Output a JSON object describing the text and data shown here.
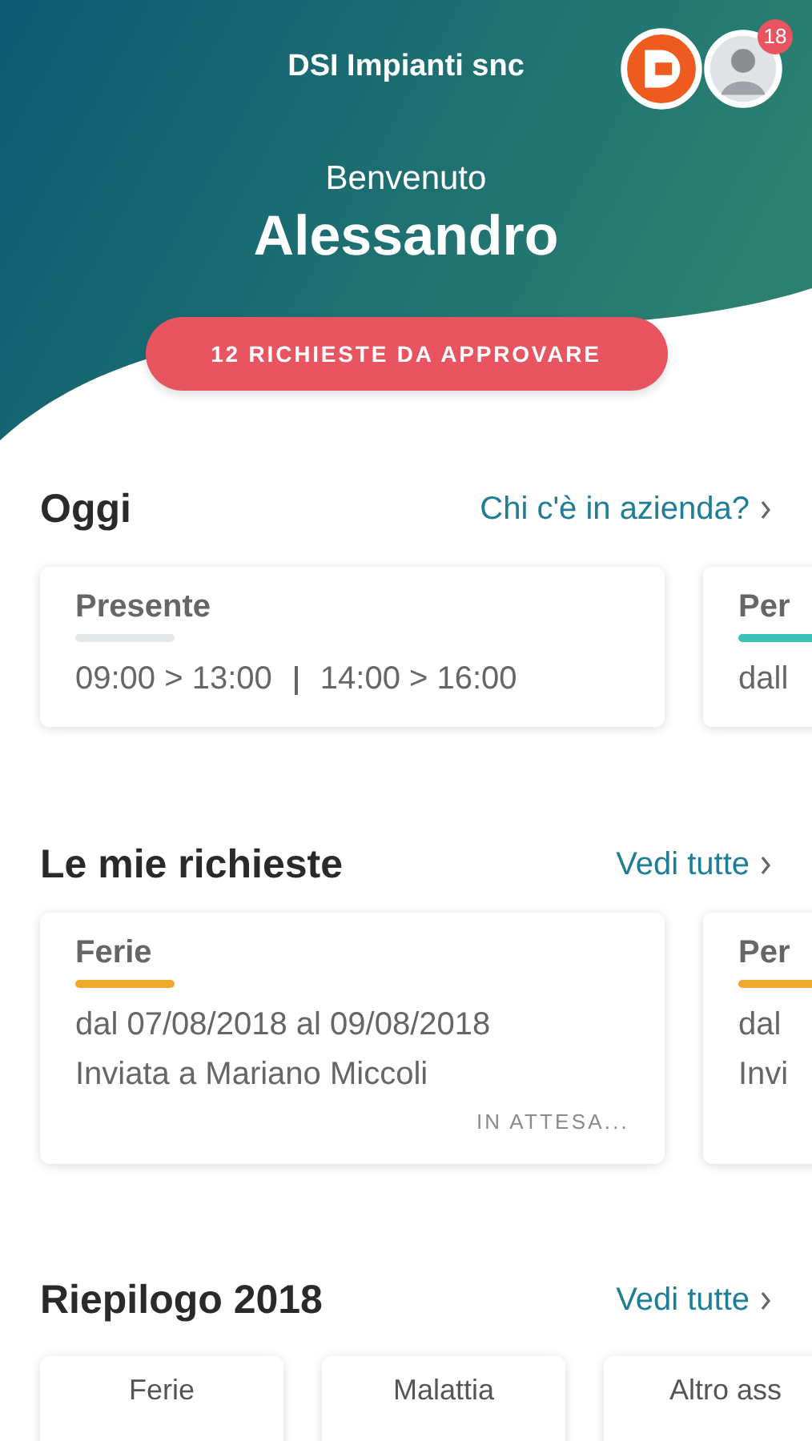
{
  "header": {
    "company": "DSI Impianti snc",
    "notification_count": "18",
    "greeting": "Benvenuto",
    "name": "Alessandro",
    "approve_button": "12 RICHIESTE DA APPROVARE"
  },
  "sections": [
    {
      "kind": "today",
      "title": "Oggi",
      "link": "Chi c'è in azienda?",
      "cards": [
        {
          "title": "Presente",
          "color": "#e3e9e9",
          "lines": [
            "09:00 > 13:00",
            "14:00 > 16:00"
          ]
        },
        {
          "title": "Per",
          "color": "#3bbfb5",
          "lines": [
            "dall"
          ]
        }
      ]
    },
    {
      "kind": "requests",
      "title": "Le mie richieste",
      "link": "Vedi tutte",
      "cards": [
        {
          "title": "Ferie",
          "color": "#f0a92b",
          "lines": [
            "dal 07/08/2018 al 09/08/2018",
            "Inviata a Mariano Miccoli"
          ],
          "status": "IN ATTESA..."
        },
        {
          "title": "Per",
          "color": "#f0a92b",
          "lines": [
            "dal",
            "Invi"
          ]
        }
      ]
    },
    {
      "kind": "summary",
      "title": "Riepilogo 2018",
      "link": "Vedi tutte",
      "cards": [
        {
          "title": "Ferie"
        },
        {
          "title": "Malattia"
        },
        {
          "title": "Altro ass"
        }
      ]
    }
  ]
}
